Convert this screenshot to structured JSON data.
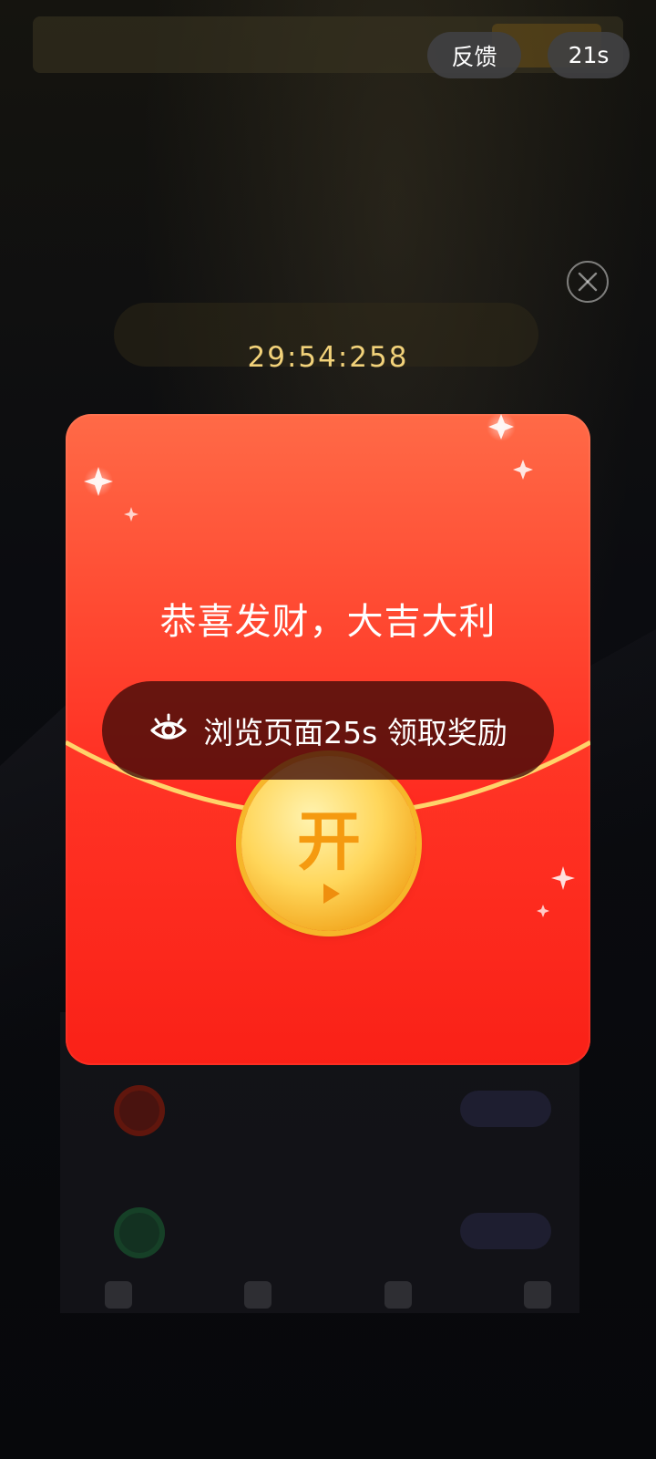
{
  "top_bar": {
    "feedback_label": "反馈",
    "timer_label": "21s"
  },
  "countdown": "29:54:258",
  "packet": {
    "greeting": "恭喜发财，大吉大利",
    "browse_label": "浏览页面25s 领取奖励",
    "coin_char": "开"
  },
  "colors": {
    "packet_top": "#ff6a47",
    "packet_bottom": "#f31511",
    "gold": "#f6b62a",
    "countdown": "#f2d27a"
  }
}
